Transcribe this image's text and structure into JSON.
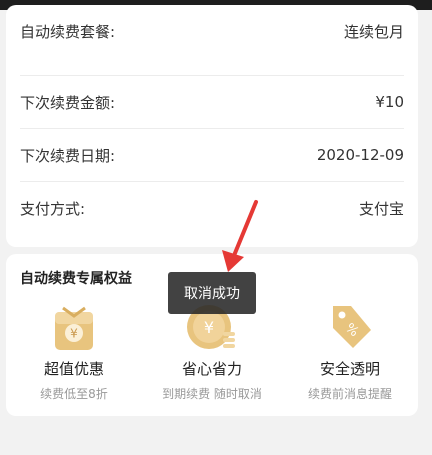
{
  "colors": {
    "accent_gold": "#e6c27a",
    "arrow_red": "#e53935",
    "toast_bg": "#282828"
  },
  "subscription": {
    "rows": [
      {
        "label": "自动续费套餐:",
        "value": "连续包月"
      },
      {
        "label": "下次续费金额:",
        "value": "¥10"
      },
      {
        "label": "下次续费日期:",
        "value": "2020-12-09"
      },
      {
        "label": "支付方式:",
        "value": "支付宝"
      }
    ]
  },
  "benefits": {
    "title": "自动续费专属权益",
    "items": [
      {
        "icon": "gift-pack-icon",
        "name": "超值优惠",
        "desc": "续费低至8折"
      },
      {
        "icon": "coin-icon",
        "name": "省心省力",
        "desc": "到期续费  随时取消"
      },
      {
        "icon": "discount-tag-icon",
        "name": "安全透明",
        "desc": "续费前消息提醒"
      }
    ]
  },
  "toast": {
    "text": "取消成功"
  }
}
